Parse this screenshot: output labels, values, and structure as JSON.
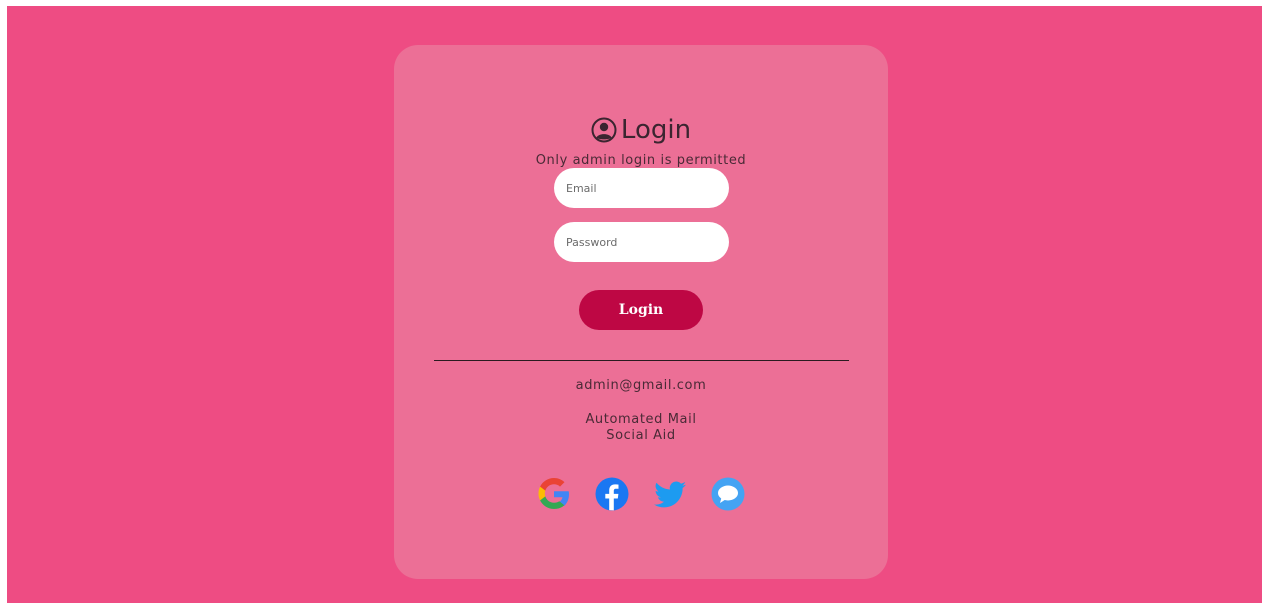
{
  "login": {
    "title": "Login",
    "subtitle": "Only admin login is permitted",
    "email_placeholder": "Email",
    "password_placeholder": "Password",
    "button_label": "Login"
  },
  "footer": {
    "contact_email": "admin@gmail.com",
    "line1": "Automated Mail",
    "line2": "Social Aid"
  },
  "social": [
    {
      "name": "google-icon"
    },
    {
      "name": "facebook-icon"
    },
    {
      "name": "twitter-icon"
    },
    {
      "name": "messenger-icon"
    }
  ],
  "colors": {
    "background": "#ee4c83",
    "card": "#ec6f96",
    "button": "#be0744"
  }
}
